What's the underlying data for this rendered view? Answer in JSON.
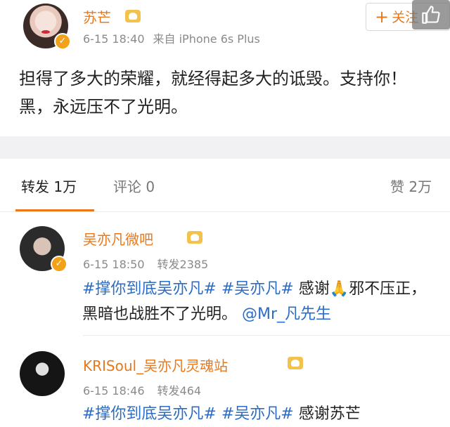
{
  "post": {
    "author": "苏芒",
    "time": "6-15 18:40",
    "source": "来自 iPhone 6s Plus",
    "follow_label": "关注",
    "text": "担得了多大的荣耀，就经得起多大的诋毁。支持你！黑，永远压不了光明。"
  },
  "tabs": {
    "repost": "转发 1万",
    "comment": "评论 0",
    "like": "赞 2万"
  },
  "reposts": [
    {
      "name": "吴亦凡微吧",
      "time": "6-15 18:50",
      "count": "转发2385",
      "tags": "#撑你到底吴亦凡# #吴亦凡#",
      "text_mid": " 感谢🙏邪不压正，黑暗也战胜不了光明。",
      "mention": "@Mr_凡先生"
    },
    {
      "name": "KRISoul_吴亦凡灵魂站",
      "time": "6-15 18:46",
      "count": "转发464",
      "tags": "#撑你到底吴亦凡# #吴亦凡#",
      "text_mid": " 感谢苏芒"
    }
  ],
  "colors": {
    "accent": "#e8781a",
    "link": "#2b6cc4",
    "badge": "#f1a21a"
  }
}
